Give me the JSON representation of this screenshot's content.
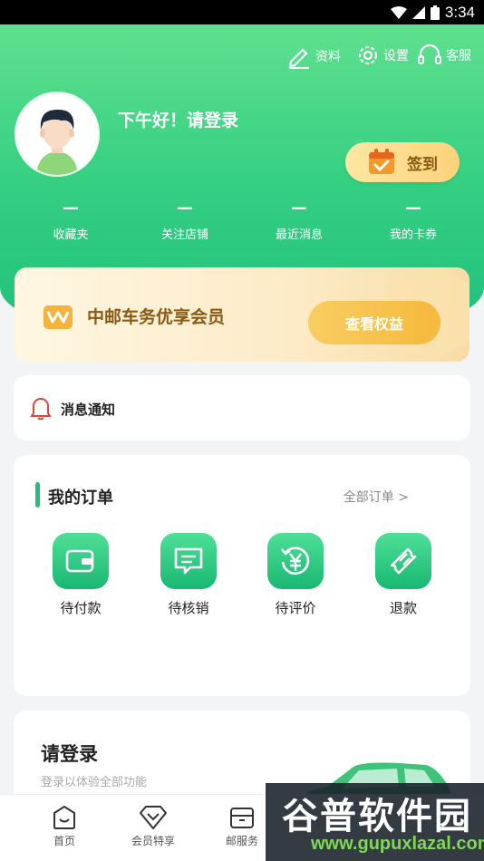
{
  "status_bar": {
    "time": "3:34"
  },
  "header": {
    "actions": [
      {
        "label": "资料",
        "icon": "pencil-icon"
      },
      {
        "label": "设置",
        "icon": "gear-icon"
      },
      {
        "label": "客服",
        "icon": "headset-icon"
      }
    ],
    "greeting": "下午好！请登录",
    "checkin_label": "签到"
  },
  "stats": [
    {
      "value": "—",
      "label": "收藏夹"
    },
    {
      "value": "—",
      "label": "关注店铺"
    },
    {
      "value": "—",
      "label": "最近消息"
    },
    {
      "value": "—",
      "label": "我的卡券"
    }
  ],
  "member": {
    "title": "中邮车务优享会员",
    "button": "查看权益"
  },
  "notification": {
    "label": "消息通知"
  },
  "orders": {
    "title": "我的订单",
    "all_link": "全部订单 >",
    "items": [
      {
        "label": "待付款",
        "icon": "wallet-icon"
      },
      {
        "label": "待核销",
        "icon": "message-icon"
      },
      {
        "label": "待评价",
        "icon": "yen-refresh-icon"
      },
      {
        "label": "退款",
        "icon": "ticket-icon"
      }
    ]
  },
  "login": {
    "title": "请登录",
    "subtitle": "登录以体验全部功能"
  },
  "tabbar": [
    {
      "label": "首页",
      "icon": "home-icon"
    },
    {
      "label": "会员特享",
      "icon": "diamond-icon"
    },
    {
      "label": "邮服务",
      "icon": "box-icon"
    }
  ],
  "watermark": {
    "logo": "谷普软件园",
    "url": "www.gupuxlazal.com"
  },
  "colors": {
    "accent_green": "#22c07d",
    "gold": "#f6b93b"
  }
}
